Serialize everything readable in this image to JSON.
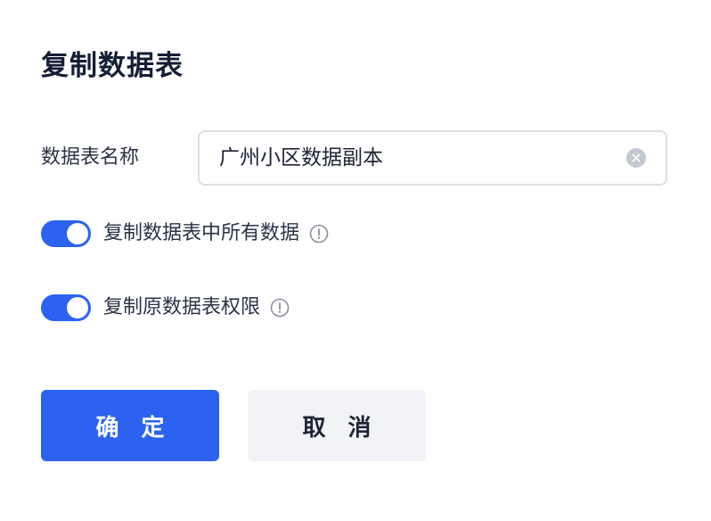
{
  "dialog": {
    "title": "复制数据表"
  },
  "name_field": {
    "label": "数据表名称",
    "value": "广州小区数据副本"
  },
  "options": [
    {
      "label": "复制数据表中所有数据",
      "enabled": true
    },
    {
      "label": "复制原数据表权限",
      "enabled": true
    }
  ],
  "buttons": {
    "confirm": "确 定",
    "cancel": "取 消"
  },
  "colors": {
    "accent": "#2c62f0",
    "title": "#141e35",
    "text": "#2b3345",
    "cancel_bg": "#f2f3f6"
  }
}
